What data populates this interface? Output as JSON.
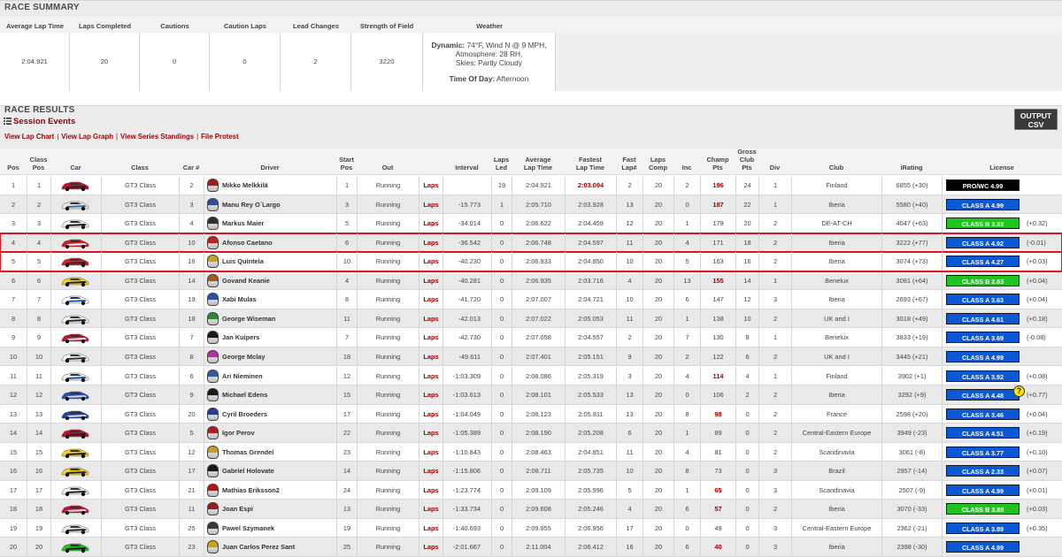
{
  "summary": {
    "title": "RACE SUMMARY",
    "headers": [
      "Average Lap Time",
      "Laps Completed",
      "Cautions",
      "Caution Laps",
      "Lead Changes",
      "Strength of Field",
      "Weather"
    ],
    "values": [
      "2:04.921",
      "20",
      "0",
      "0",
      "2",
      "3220"
    ],
    "weather": {
      "dynamic_label": "Dynamic:",
      "line1": "74°F, Wind N @ 9 MPH,",
      "line2": "Atmosphere: 28 RH,",
      "line3": "Skies: Partly Cloudy",
      "tod_label": "Time Of Day:",
      "tod_value": "Afternoon"
    }
  },
  "results": {
    "title": "RACE RESULTS",
    "session_events": "Session Events",
    "links": [
      "View Lap Chart",
      "View Lap Graph",
      "View Series Standings",
      "File Protest"
    ],
    "csv_line1": "OUTPUT",
    "csv_line2": "CSV"
  },
  "columns": {
    "pos": "Pos",
    "class_pos_1": "Class",
    "class_pos_2": "Pos",
    "car": "Car",
    "class": "Class",
    "carnum": "Car #",
    "driver": "Driver",
    "start_1": "Start",
    "start_2": "Pos",
    "out": "Out",
    "interval": "Interval",
    "laps_led_1": "Laps",
    "laps_led_2": "Led",
    "avg_1": "Average",
    "avg_2": "Lap Time",
    "fast_1": "Fastest",
    "fast_2": "Lap Time",
    "flap_1": "Fast",
    "flap_2": "Lap#",
    "lcomp_1": "Laps",
    "lcomp_2": "Comp",
    "inc": "Inc",
    "champ_1": "Champ",
    "champ_2": "Pts",
    "gross_1": "Gross",
    "gross_2": "Club",
    "gross_3": "Pts",
    "div": "Div",
    "club": "Club",
    "irating": "iRating",
    "license": "License"
  },
  "colors": {
    "link_red": "#a00000",
    "highlight": "#e0161f",
    "license_blue": "#0a58d6",
    "license_green": "#1fc51f",
    "license_black": "#000000"
  },
  "rows": [
    {
      "pos": "1",
      "cpos": "1",
      "class": "GT3 Class",
      "num": "2",
      "driver": "Mikko Melkkilä",
      "start": "1",
      "out": "Running",
      "laps": "Laps",
      "interval": "",
      "led": "19",
      "avg": "2:04.921",
      "fast": "2:03.094",
      "fast_best": true,
      "flap": "2",
      "comp": "20",
      "inc": "2",
      "champ": "196",
      "champ_red": true,
      "gross": "24",
      "div": "1",
      "club": "Finland",
      "irating": "6855 (+30)",
      "license": "PRO/WC 4.99",
      "lic_color": "#000000",
      "delta": "",
      "car_colors": [
        "#c8102e",
        "#222222"
      ],
      "helm": "#b01818"
    },
    {
      "pos": "2",
      "cpos": "2",
      "class": "GT3 Class",
      "num": "3",
      "driver": "Manu Rey O´Largo",
      "start": "3",
      "out": "Running",
      "laps": "Laps",
      "interval": "-15.773",
      "led": "1",
      "avg": "2:05.710",
      "fast": "2:03.928",
      "fast_best": false,
      "flap": "13",
      "comp": "20",
      "inc": "0",
      "champ": "187",
      "champ_red": true,
      "gross": "22",
      "div": "1",
      "club": "Iberia",
      "irating": "5580 (+40)",
      "license": "CLASS A 4.99",
      "lic_color": "#0a58d6",
      "delta": "",
      "car_colors": [
        "#e8e8e8",
        "#2a6fb5"
      ],
      "helm": "#2a4f9a"
    },
    {
      "pos": "3",
      "cpos": "3",
      "class": "GT3 Class",
      "num": "4",
      "driver": "Markus Maier",
      "start": "5",
      "out": "Running",
      "laps": "Laps",
      "interval": "-34.014",
      "led": "0",
      "avg": "2:06.622",
      "fast": "2:04.459",
      "fast_best": false,
      "flap": "12",
      "comp": "20",
      "inc": "1",
      "champ": "179",
      "champ_red": false,
      "gross": "20",
      "div": "2",
      "club": "DE-AT-CH",
      "irating": "4047 (+63)",
      "license": "CLASS B 3.82",
      "lic_color": "#1fc51f",
      "delta": "(+0.32)",
      "car_colors": [
        "#f0f0f0",
        "#1a1a1a"
      ],
      "helm": "#303030"
    },
    {
      "pos": "4",
      "cpos": "4",
      "class": "GT3 Class",
      "num": "10",
      "driver": "Afonso Caetano",
      "start": "6",
      "out": "Running",
      "laps": "Laps",
      "interval": "-36.542",
      "led": "0",
      "avg": "2:06.748",
      "fast": "2:04.597",
      "fast_best": false,
      "flap": "11",
      "comp": "20",
      "inc": "4",
      "champ": "171",
      "champ_red": false,
      "gross": "18",
      "div": "2",
      "club": "Iberia",
      "irating": "3222 (+77)",
      "license": "CLASS A 4.92",
      "lic_color": "#0a58d6",
      "delta": "(-0.01)",
      "car_colors": [
        "#d81c2a",
        "#f2f2f2"
      ],
      "helm": "#c02020"
    },
    {
      "pos": "5",
      "cpos": "5",
      "class": "GT3 Class",
      "num": "16",
      "driver": "Luis Quintela",
      "start": "10",
      "out": "Running",
      "laps": "Laps",
      "interval": "-40.230",
      "led": "0",
      "avg": "2:06.933",
      "fast": "2:04.850",
      "fast_best": false,
      "flap": "10",
      "comp": "20",
      "inc": "5",
      "champ": "163",
      "champ_red": false,
      "gross": "16",
      "div": "2",
      "club": "Iberia",
      "irating": "3074 (+73)",
      "license": "CLASS A 4.27",
      "lic_color": "#0a58d6",
      "delta": "(+0.03)",
      "car_colors": [
        "#d4202c",
        "#2a2a2a"
      ],
      "helm": "#c8a020"
    },
    {
      "pos": "6",
      "cpos": "6",
      "class": "GT3 Class",
      "num": "14",
      "driver": "Govand Keanie",
      "start": "4",
      "out": "Running",
      "laps": "Laps",
      "interval": "-40.281",
      "led": "0",
      "avg": "2:06.935",
      "fast": "2:03.716",
      "fast_best": false,
      "flap": "4",
      "comp": "20",
      "inc": "13",
      "champ": "155",
      "champ_red": true,
      "gross": "14",
      "div": "1",
      "club": "Benelux",
      "irating": "3081 (+64)",
      "license": "CLASS B 2.63",
      "lic_color": "#1fc51f",
      "delta": "(+0.04)",
      "car_colors": [
        "#f3d21a",
        "#222222"
      ],
      "helm": "#a85a10"
    },
    {
      "pos": "7",
      "cpos": "7",
      "class": "GT3 Class",
      "num": "19",
      "driver": "Xabi Mulas",
      "start": "8",
      "out": "Running",
      "laps": "Laps",
      "interval": "-41.720",
      "led": "0",
      "avg": "2:07.007",
      "fast": "2:04.721",
      "fast_best": false,
      "flap": "10",
      "comp": "20",
      "inc": "6",
      "champ": "147",
      "champ_red": false,
      "gross": "12",
      "div": "3",
      "club": "Iberia",
      "irating": "2693 (+67)",
      "license": "CLASS A 3.63",
      "lic_color": "#0a58d6",
      "delta": "(+0.04)",
      "car_colors": [
        "#ffffff",
        "#1f5fb5"
      ],
      "helm": "#2a50a8"
    },
    {
      "pos": "8",
      "cpos": "8",
      "class": "GT3 Class",
      "num": "18",
      "driver": "George Wiseman",
      "start": "11",
      "out": "Running",
      "laps": "Laps",
      "interval": "-42.013",
      "led": "0",
      "avg": "2:07.022",
      "fast": "2:05.053",
      "fast_best": false,
      "flap": "11",
      "comp": "20",
      "inc": "1",
      "champ": "138",
      "champ_red": false,
      "gross": "10",
      "div": "2",
      "club": "UK and I",
      "irating": "3018 (+49)",
      "license": "CLASS A 4.61",
      "lic_color": "#0a58d6",
      "delta": "(+0.18)",
      "car_colors": [
        "#f5f5f5",
        "#2a2a2a"
      ],
      "helm": "#2a8a3a"
    },
    {
      "pos": "9",
      "cpos": "9",
      "class": "GT3 Class",
      "num": "7",
      "driver": "Jan Kuipers",
      "start": "7",
      "out": "Running",
      "laps": "Laps",
      "interval": "-42.730",
      "led": "0",
      "avg": "2:07.058",
      "fast": "2:04.557",
      "fast_best": false,
      "flap": "2",
      "comp": "20",
      "inc": "7",
      "champ": "130",
      "champ_red": false,
      "gross": "8",
      "div": "1",
      "club": "Benelux",
      "irating": "3833 (+19)",
      "license": "CLASS A 3.69",
      "lic_color": "#0a58d6",
      "delta": "(-0.08)",
      "car_colors": [
        "#c8102e",
        "#f0f0f0"
      ],
      "helm": "#1a1a1a"
    },
    {
      "pos": "10",
      "cpos": "10",
      "class": "GT3 Class",
      "num": "8",
      "driver": "George Mclay",
      "start": "18",
      "out": "Running",
      "laps": "Laps",
      "interval": "-49.611",
      "led": "0",
      "avg": "2:07.401",
      "fast": "2:05.151",
      "fast_best": false,
      "flap": "9",
      "comp": "20",
      "inc": "2",
      "champ": "122",
      "champ_red": false,
      "gross": "6",
      "div": "2",
      "club": "UK and I",
      "irating": "3445 (+21)",
      "license": "CLASS A 4.99",
      "lic_color": "#0a58d6",
      "delta": "",
      "car_colors": [
        "#f8f8f8",
        "#303030"
      ],
      "helm": "#c02aa0"
    },
    {
      "pos": "11",
      "cpos": "11",
      "class": "GT3 Class",
      "num": "6",
      "driver": "Ari Nieminen",
      "start": "12",
      "out": "Running",
      "laps": "Laps",
      "interval": "-1:03.309",
      "led": "0",
      "avg": "2:08.086",
      "fast": "2:05.319",
      "fast_best": false,
      "flap": "3",
      "comp": "20",
      "inc": "4",
      "champ": "114",
      "champ_red": true,
      "gross": "4",
      "div": "1",
      "club": "Finland",
      "irating": "3902 (+1)",
      "license": "CLASS A 3.92",
      "lic_color": "#0a58d6",
      "delta": "(+0.08)",
      "car_colors": [
        "#f0f0f0",
        "#2050b0"
      ],
      "helm": "#2a5ab0"
    },
    {
      "pos": "12",
      "cpos": "12",
      "class": "GT3 Class",
      "num": "9",
      "driver": "Michael Edens",
      "start": "15",
      "out": "Running",
      "laps": "Laps",
      "interval": "-1:03.613",
      "led": "0",
      "avg": "2:08.101",
      "fast": "2:05.533",
      "fast_best": false,
      "flap": "13",
      "comp": "20",
      "inc": "0",
      "champ": "106",
      "champ_red": false,
      "gross": "2",
      "div": "2",
      "club": "Iberia",
      "irating": "3292 (+9)",
      "license": "CLASS A 4.48",
      "lic_color": "#0a58d6",
      "delta": "(+0.77)",
      "help": true,
      "car_colors": [
        "#2a4fb0",
        "#d8d8d8"
      ],
      "helm": "#1a1a1a"
    },
    {
      "pos": "13",
      "cpos": "13",
      "class": "GT3 Class",
      "num": "20",
      "driver": "Cyril Broeders",
      "start": "17",
      "out": "Running",
      "laps": "Laps",
      "interval": "-1:04.049",
      "led": "0",
      "avg": "2:08.123",
      "fast": "2:05.811",
      "fast_best": false,
      "flap": "13",
      "comp": "20",
      "inc": "8",
      "champ": "98",
      "champ_red": true,
      "gross": "0",
      "div": "2",
      "club": "France",
      "irating": "2598 (+20)",
      "license": "CLASS A 3.46",
      "lic_color": "#0a58d6",
      "delta": "(+0.04)",
      "car_colors": [
        "#2040a0",
        "#e0e0e0"
      ],
      "helm": "#1e3c9a"
    },
    {
      "pos": "14",
      "cpos": "14",
      "class": "GT3 Class",
      "num": "5",
      "driver": "Igor Perov",
      "start": "22",
      "out": "Running",
      "laps": "Laps",
      "interval": "-1:05.389",
      "led": "0",
      "avg": "2:08.190",
      "fast": "2:05.208",
      "fast_best": false,
      "flap": "6",
      "comp": "20",
      "inc": "1",
      "champ": "89",
      "champ_red": false,
      "gross": "0",
      "div": "2",
      "club": "Central-Eastern Europe",
      "irating": "3949 (-23)",
      "license": "CLASS A 4.51",
      "lic_color": "#0a58d6",
      "delta": "(+0.19)",
      "car_colors": [
        "#c8102e",
        "#222222"
      ],
      "helm": "#b81820"
    },
    {
      "pos": "15",
      "cpos": "15",
      "class": "GT3 Class",
      "num": "12",
      "driver": "Thomas Grendel",
      "start": "23",
      "out": "Running",
      "laps": "Laps",
      "interval": "-1:10.843",
      "led": "0",
      "avg": "2:08.463",
      "fast": "2:04.851",
      "fast_best": false,
      "flap": "11",
      "comp": "20",
      "inc": "4",
      "champ": "81",
      "champ_red": false,
      "gross": "0",
      "div": "2",
      "club": "Scandinavia",
      "irating": "3061 (-8)",
      "license": "CLASS A 3.77",
      "lic_color": "#0a58d6",
      "delta": "(+0.10)",
      "car_colors": [
        "#f3d21a",
        "#1a1a1a"
      ],
      "helm": "#c8a020"
    },
    {
      "pos": "16",
      "cpos": "16",
      "class": "GT3 Class",
      "num": "17",
      "driver": "Gabriel Holovate",
      "start": "14",
      "out": "Running",
      "laps": "Laps",
      "interval": "-1:15.806",
      "led": "0",
      "avg": "2:08.711",
      "fast": "2:05.735",
      "fast_best": false,
      "flap": "10",
      "comp": "20",
      "inc": "8",
      "champ": "73",
      "champ_red": false,
      "gross": "0",
      "div": "3",
      "club": "Brazil",
      "irating": "2957 (-14)",
      "license": "CLASS A 2.33",
      "lic_color": "#0a58d6",
      "delta": "(+0.07)",
      "car_colors": [
        "#f3d21a",
        "#2a2a2a"
      ],
      "helm": "#1a1a1a"
    },
    {
      "pos": "17",
      "cpos": "17",
      "class": "GT3 Class",
      "num": "21",
      "driver": "Mathias Eriksson2",
      "start": "24",
      "out": "Running",
      "laps": "Laps",
      "interval": "-1:23.774",
      "led": "0",
      "avg": "2:09.109",
      "fast": "2:05.996",
      "fast_best": false,
      "flap": "5",
      "comp": "20",
      "inc": "1",
      "champ": "65",
      "champ_red": true,
      "gross": "0",
      "div": "3",
      "club": "Scandinavia",
      "irating": "2507 (-9)",
      "license": "CLASS A 4.99",
      "lic_color": "#0a58d6",
      "delta": "(+0.01)",
      "car_colors": [
        "#f0f0f0",
        "#202020"
      ],
      "helm": "#b01818"
    },
    {
      "pos": "18",
      "cpos": "18",
      "class": "GT3 Class",
      "num": "11",
      "driver": "Joan Espi",
      "start": "13",
      "out": "Running",
      "laps": "Laps",
      "interval": "-1:33.734",
      "led": "0",
      "avg": "2:09.608",
      "fast": "2:05.246",
      "fast_best": false,
      "flap": "4",
      "comp": "20",
      "inc": "6",
      "champ": "57",
      "champ_red": true,
      "gross": "0",
      "div": "2",
      "club": "Iberia",
      "irating": "3070 (-33)",
      "license": "CLASS B 3.88",
      "lic_color": "#1fc51f",
      "delta": "(+0.03)",
      "car_colors": [
        "#c8102e",
        "#e8e8e8"
      ],
      "helm": "#a01818"
    },
    {
      "pos": "19",
      "cpos": "19",
      "class": "GT3 Class",
      "num": "25",
      "driver": "Pawel Szymanek",
      "start": "19",
      "out": "Running",
      "laps": "Laps",
      "interval": "-1:40.693",
      "led": "0",
      "avg": "2:09.955",
      "fast": "2:06.956",
      "fast_best": false,
      "flap": "17",
      "comp": "20",
      "inc": "0",
      "champ": "49",
      "champ_red": false,
      "gross": "0",
      "div": "3",
      "club": "Central-Eastern Europe",
      "irating": "2362 (-21)",
      "license": "CLASS A 3.89",
      "lic_color": "#0a58d6",
      "delta": "(+0.35)",
      "car_colors": [
        "#e8e8e8",
        "#2a2a2a"
      ],
      "helm": "#3a3a3a"
    },
    {
      "pos": "20",
      "cpos": "20",
      "class": "GT3 Class",
      "num": "23",
      "driver": "Juan Carlos Perez Sant",
      "start": "25",
      "out": "Running",
      "laps": "Laps",
      "interval": "-2:01.667",
      "led": "0",
      "avg": "2:11.004",
      "fast": "2:06.412",
      "fast_best": false,
      "flap": "16",
      "comp": "20",
      "inc": "6",
      "champ": "40",
      "champ_red": true,
      "gross": "0",
      "div": "3",
      "club": "Iberia",
      "irating": "2398 (-30)",
      "license": "CLASS A 4.99",
      "lic_color": "#0a58d6",
      "delta": "",
      "car_colors": [
        "#22c422",
        "#1a1a1a"
      ],
      "helm": "#c8a020"
    }
  ]
}
